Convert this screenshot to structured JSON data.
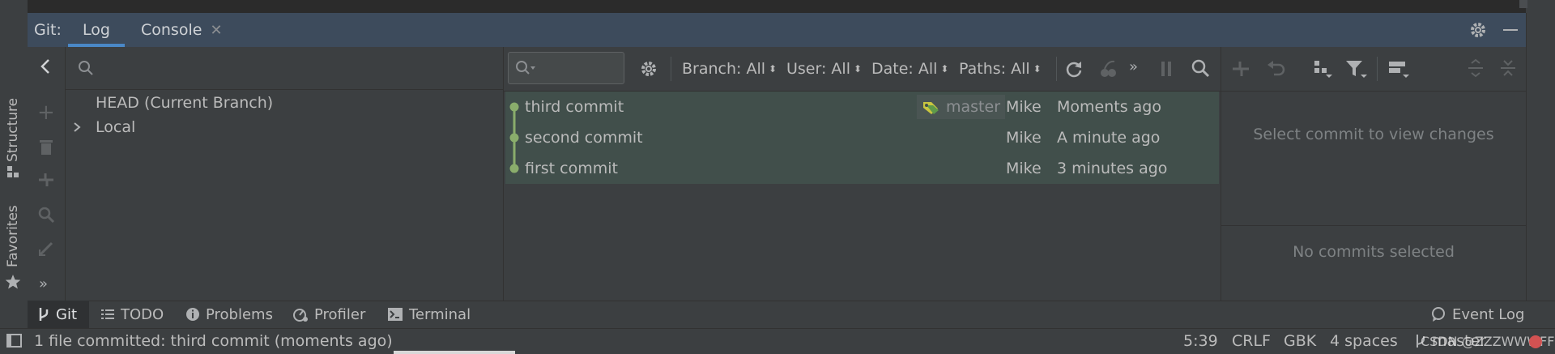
{
  "tool_window": {
    "title": "Git:",
    "tabs": [
      {
        "label": "Log",
        "active": true
      },
      {
        "label": "Console",
        "closable": true
      }
    ]
  },
  "left_stripe": {
    "items": [
      {
        "label": "Structure",
        "icon": "structure-icon"
      },
      {
        "label": "Favorites",
        "icon": "star-icon"
      }
    ]
  },
  "branches": {
    "search_placeholder": "",
    "items": [
      {
        "label": "HEAD (Current Branch)"
      },
      {
        "label": "Local",
        "expandable": true
      }
    ]
  },
  "log": {
    "search_placeholder": "",
    "filters": [
      {
        "label": "Branch: All"
      },
      {
        "label": "User: All"
      },
      {
        "label": "Date: All"
      },
      {
        "label": "Paths: All"
      }
    ],
    "commits": [
      {
        "subject": "third commit",
        "ref": "master",
        "author": "Mike",
        "date": "Moments ago",
        "selected": true
      },
      {
        "subject": "second commit",
        "ref": "",
        "author": "Mike",
        "date": "A minute ago",
        "selected": true
      },
      {
        "subject": "first commit",
        "ref": "",
        "author": "Mike",
        "date": "3 minutes ago",
        "selected": true
      }
    ]
  },
  "details": {
    "changes_placeholder": "Select commit to view changes",
    "details_placeholder": "No commits selected"
  },
  "bottom_tools": [
    {
      "label": "Git",
      "icon": "git-branch-icon",
      "active": true
    },
    {
      "label": "TODO",
      "icon": "list-icon"
    },
    {
      "label": "Problems",
      "icon": "info-icon"
    },
    {
      "label": "Profiler",
      "icon": "profiler-icon"
    },
    {
      "label": "Terminal",
      "icon": "terminal-icon"
    }
  ],
  "event_log": {
    "label": "Event Log"
  },
  "status_bar": {
    "message": "1 file committed: third commit (moments ago)",
    "position": "5:39",
    "line_separator": "CRLF",
    "encoding": "GBK",
    "indent": "4 spaces",
    "branch": "master",
    "watermark": "CSDN @ZZZWWWFFF"
  },
  "colors": {
    "graph_node": "#8aad6c",
    "header_bg": "#3d4b5c",
    "selected_row": "#414f4b",
    "active_tab_underline": "#4a88c7",
    "tag_icon": "#c9c640"
  }
}
